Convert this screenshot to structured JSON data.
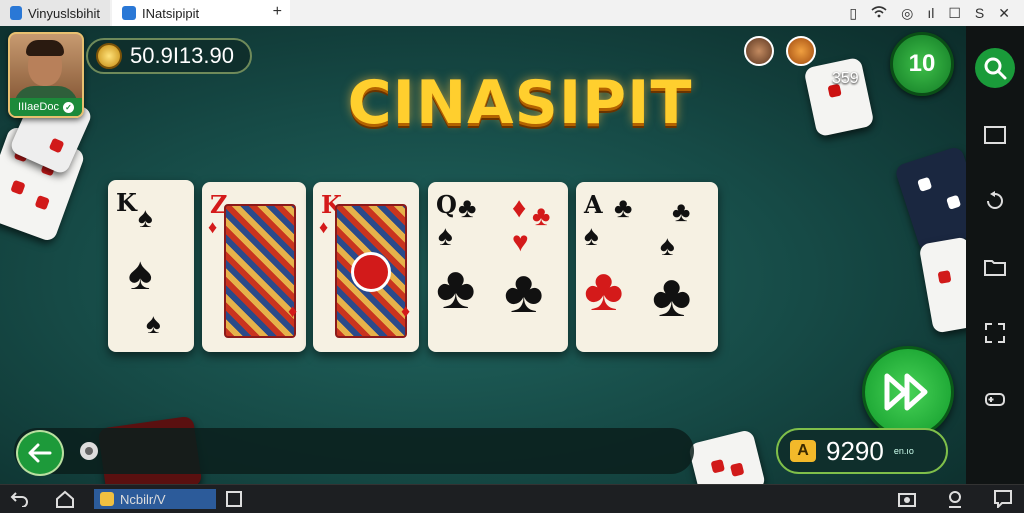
{
  "browser": {
    "tabs": [
      {
        "label": "Vinyuslsbihit",
        "active": false
      },
      {
        "label": "INatsipipit",
        "active": true
      }
    ],
    "new_tab": "+"
  },
  "player": {
    "name": "IIIaeDoc",
    "balance": "50.9I13.90"
  },
  "logo": {
    "text": "CINASIPIT"
  },
  "opponents": {
    "count": "359"
  },
  "level": {
    "value": "10"
  },
  "hand": {
    "cards": [
      {
        "rank": "K",
        "suit": "♠",
        "color": "black"
      },
      {
        "rank": "Z",
        "suit": "♦",
        "color": "red"
      },
      {
        "rank": "K",
        "suit": "♦",
        "color": "red"
      },
      {
        "rank": "Q",
        "suit": "♣",
        "color": "black"
      },
      {
        "rank": "A",
        "suit": "♣",
        "color": "black"
      }
    ]
  },
  "winnings": {
    "value": "9290",
    "prefix": "A",
    "suffix": "en.ıo"
  },
  "taskbar": {
    "app_label": "Ncbilr/V"
  }
}
